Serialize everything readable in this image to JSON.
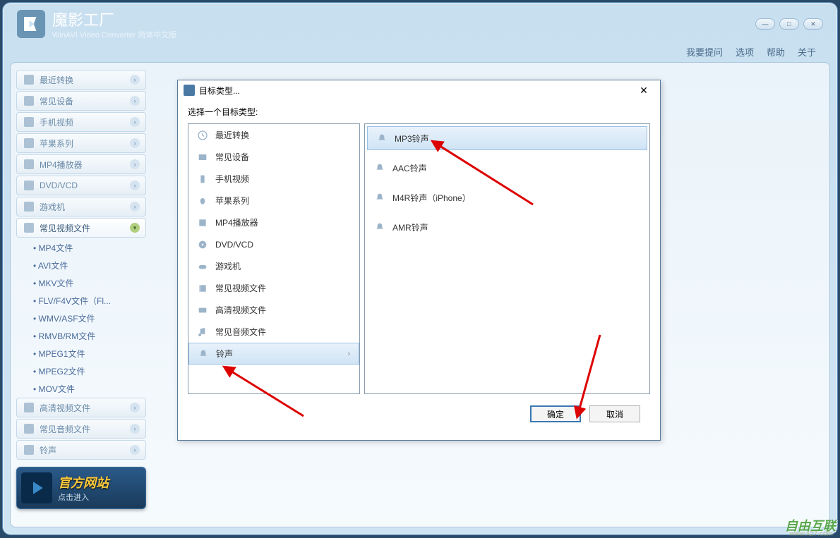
{
  "app": {
    "title": "魔影工厂",
    "subtitle": "WinAVI Video Converter 简体中文版"
  },
  "menubar": [
    "我要提问",
    "选项",
    "帮助",
    "关于"
  ],
  "sidebar": {
    "items": [
      {
        "label": "最近转换",
        "icon": "clock-icon"
      },
      {
        "label": "常见设备",
        "icon": "device-icon"
      },
      {
        "label": "手机视频",
        "icon": "phone-icon"
      },
      {
        "label": "苹果系列",
        "icon": "apple-icon"
      },
      {
        "label": "MP4播放器",
        "icon": "mp4-icon"
      },
      {
        "label": "DVD/VCD",
        "icon": "disc-icon"
      },
      {
        "label": "游戏机",
        "icon": "gamepad-icon"
      }
    ],
    "expanded": {
      "label": "常见视频文件",
      "icon": "film-icon",
      "children": [
        "MP4文件",
        "AVI文件",
        "MKV文件",
        "FLV/F4V文件（Fl...",
        "WMV/ASF文件",
        "RMVB/RM文件",
        "MPEG1文件",
        "MPEG2文件",
        "MOV文件"
      ]
    },
    "after": [
      {
        "label": "高清视频文件",
        "icon": "hd-icon"
      },
      {
        "label": "常见音频文件",
        "icon": "music-icon"
      },
      {
        "label": "铃声",
        "icon": "bell-icon"
      }
    ]
  },
  "banner": {
    "title": "官方网站",
    "subtitle": "点击进入"
  },
  "dialog": {
    "title": "目标类型...",
    "prompt": "选择一个目标类型:",
    "categories": [
      {
        "label": "最近转换",
        "icon": "clock"
      },
      {
        "label": "常见设备",
        "icon": "device"
      },
      {
        "label": "手机视频",
        "icon": "phone"
      },
      {
        "label": "苹果系列",
        "icon": "apple"
      },
      {
        "label": "MP4播放器",
        "icon": "mp4"
      },
      {
        "label": "DVD/VCD",
        "icon": "disc"
      },
      {
        "label": "游戏机",
        "icon": "gamepad"
      },
      {
        "label": "常见视频文件",
        "icon": "film"
      },
      {
        "label": "高清视频文件",
        "icon": "hd"
      },
      {
        "label": "常见音频文件",
        "icon": "music"
      },
      {
        "label": "铃声",
        "icon": "bell",
        "selected": true
      }
    ],
    "options": [
      {
        "label": "MP3铃声",
        "selected": true
      },
      {
        "label": "AAC铃声"
      },
      {
        "label": "M4R铃声（iPhone）"
      },
      {
        "label": "AMR铃声"
      }
    ],
    "ok": "确定",
    "cancel": "取消"
  },
  "watermark": {
    "brand": "自由互联",
    "url": "www.x27.com"
  }
}
